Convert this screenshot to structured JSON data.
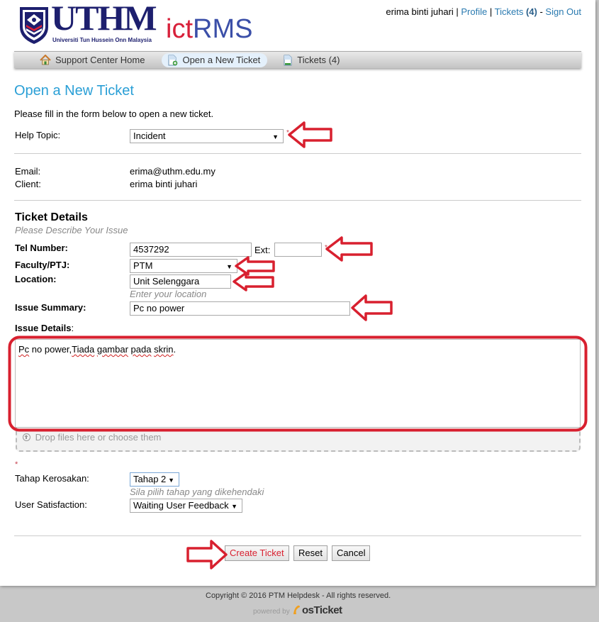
{
  "header": {
    "logo_main": "UTHM",
    "logo_sub": "Universiti Tun Hussein Onn Malaysia",
    "app_name_part1": "ict",
    "app_name_part2": "RMS",
    "user_name": "erima binti juhari",
    "sep1": " | ",
    "profile_link": "Profile",
    "sep2": " | ",
    "tickets_link": "Tickets",
    "tickets_count": "(4)",
    "sep3": " - ",
    "signout_link": "Sign Out"
  },
  "nav": {
    "items": [
      {
        "label": "Support Center Home",
        "icon": "home-icon",
        "active": false
      },
      {
        "label": "Open a New Ticket",
        "icon": "new-ticket-icon",
        "active": true
      },
      {
        "label": "Tickets (4)",
        "icon": "tickets-icon",
        "active": false
      }
    ]
  },
  "page": {
    "title": "Open a New Ticket",
    "intro": "Please fill in the form below to open a new ticket."
  },
  "form": {
    "help_topic": {
      "label": "Help Topic:",
      "value": "Incident",
      "required_mark": "*"
    },
    "email": {
      "label": "Email:",
      "value": "erima@uthm.edu.my"
    },
    "client": {
      "label": "Client:",
      "value": "erima binti juhari"
    },
    "section_title": "Ticket Details",
    "section_hint": "Please Describe Your Issue",
    "tel": {
      "label": "Tel Number:",
      "value": "4537292",
      "ext_label": "Ext:",
      "ext_value": "",
      "required_mark": "*"
    },
    "faculty": {
      "label": "Faculty/PTJ:",
      "value": "PTM"
    },
    "location": {
      "label": "Location:",
      "value": "Unit Selenggara",
      "hint": "Enter your location"
    },
    "summary": {
      "label": "Issue Summary:",
      "value": "Pc no power"
    },
    "details": {
      "label": "Issue Details",
      "label_colon": ":",
      "words": [
        "Pc",
        " no power,",
        "Tiada",
        " ",
        "gambar",
        " ",
        "pada",
        " ",
        "skrin",
        "."
      ]
    },
    "dropzone": {
      "icon": "upload-icon",
      "text": "Drop files here or choose them"
    },
    "required_mark_standalone": "*",
    "tahap": {
      "label": "Tahap Kerosakan:",
      "value": "Tahap 2",
      "hint": "Sila pilih tahap yang dikehendaki"
    },
    "satisfaction": {
      "label": "User Satisfaction:",
      "value": "Waiting User Feedback"
    },
    "buttons": {
      "create": "Create Ticket",
      "reset": "Reset",
      "cancel": "Cancel"
    }
  },
  "footer": {
    "copyright": "Copyright © 2016 PTM Helpdesk - All rights reserved.",
    "powered_by": "powered by",
    "brand": "osTicket"
  },
  "colors": {
    "title_blue": "#2a9fd6",
    "link_blue": "#2a7ab0",
    "annotation_red": "#d8202f",
    "create_button_text": "#d8202f"
  }
}
